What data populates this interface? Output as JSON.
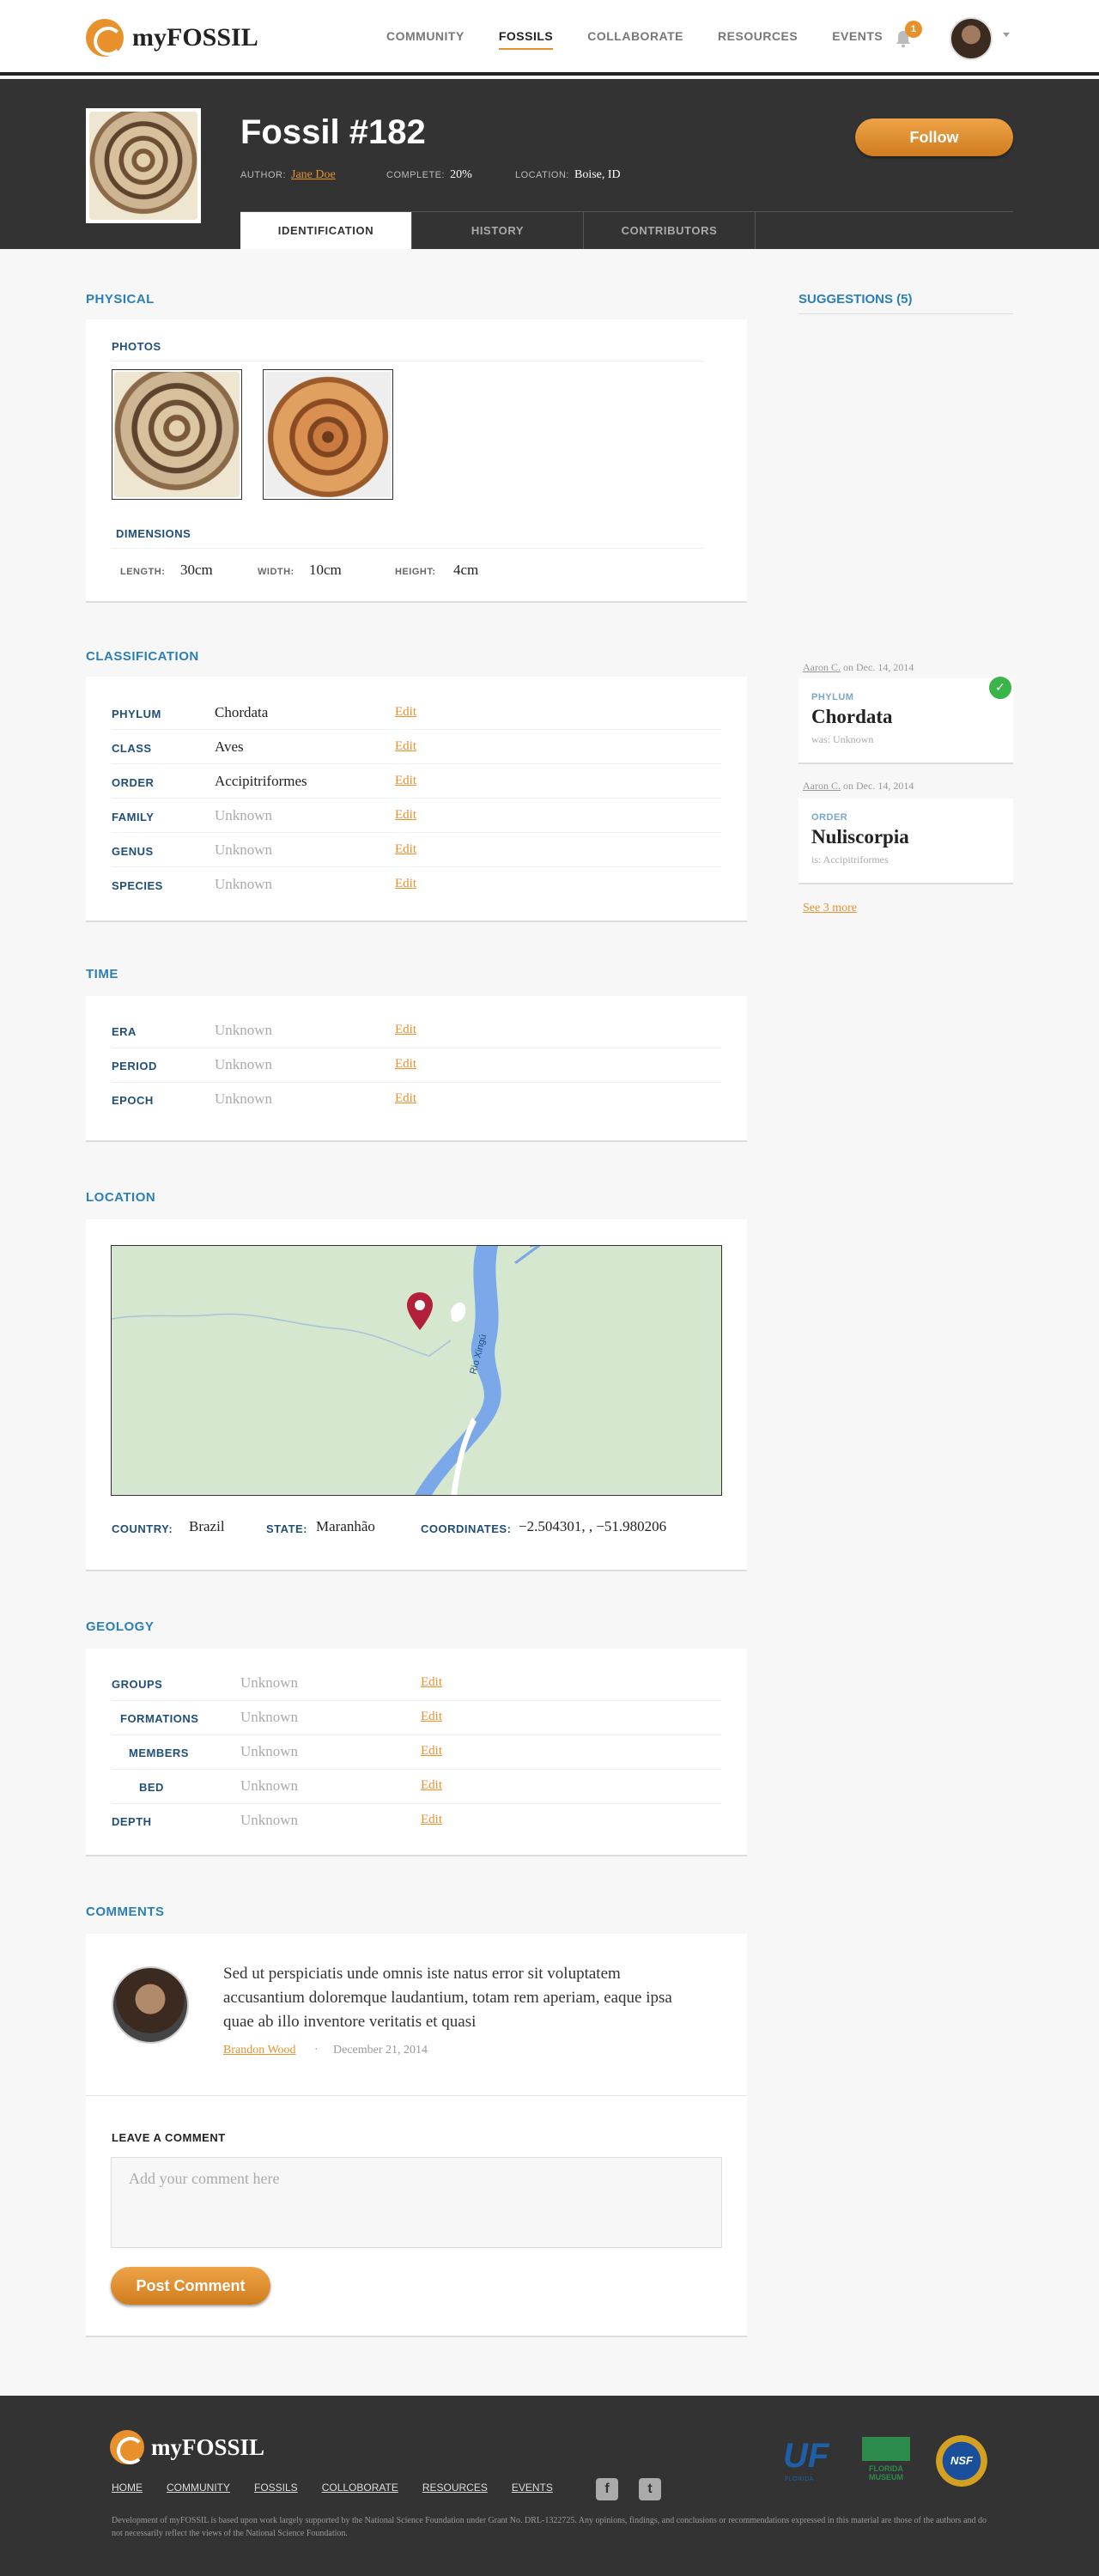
{
  "brand": {
    "name": "myFOSSIL"
  },
  "nav": {
    "items": [
      {
        "label": "COMMUNITY",
        "active": false
      },
      {
        "label": "FOSSILS",
        "active": true
      },
      {
        "label": "COLLABORATE",
        "active": false
      },
      {
        "label": "RESOURCES",
        "active": false
      },
      {
        "label": "EVENTS",
        "active": false
      }
    ],
    "notification_count": "1"
  },
  "header": {
    "title": "Fossil #182",
    "author_label": "AUTHOR:",
    "author": "Jane Doe",
    "complete_label": "COMPLETE:",
    "complete": "20%",
    "location_label": "LOCATION:",
    "location": "Boise, ID",
    "follow_label": "Follow",
    "tabs": [
      "IDENTIFICATION",
      "HISTORY",
      "CONTRIBUTORS"
    ],
    "active_tab": "IDENTIFICATION"
  },
  "physical": {
    "title": "PHYSICAL",
    "photos_label": "PHOTOS",
    "dimensions_label": "DIMENSIONS",
    "length_label": "LENGTH:",
    "length": "30cm",
    "width_label": "WIDTH:",
    "width": "10cm",
    "height_label": "HEIGHT:",
    "height": "4cm"
  },
  "edit_label": "Edit",
  "classification": {
    "title": "CLASSIFICATION",
    "rows": [
      {
        "label": "PHYLUM",
        "value": "Chordata",
        "known": true
      },
      {
        "label": "CLASS",
        "value": "Aves",
        "known": true
      },
      {
        "label": "ORDER",
        "value": "Accipitriformes",
        "known": true
      },
      {
        "label": "FAMILY",
        "value": "Unknown",
        "known": false
      },
      {
        "label": "GENUS",
        "value": "Unknown",
        "known": false
      },
      {
        "label": "SPECIES",
        "value": "Unknown",
        "known": false
      }
    ]
  },
  "time": {
    "title": "TIME",
    "rows": [
      {
        "label": "ERA",
        "value": "Unknown"
      },
      {
        "label": "PERIOD",
        "value": "Unknown"
      },
      {
        "label": "EPOCH",
        "value": "Unknown"
      }
    ]
  },
  "location": {
    "title": "LOCATION",
    "map_river_label": "Rio Xingú",
    "country_label": "COUNTRY:",
    "country": "Brazil",
    "state_label": "STATE:",
    "state": "Maranhão",
    "coordinates_label": "COORDINATES:",
    "coordinates": "−2.504301, , −51.980206"
  },
  "geology": {
    "title": "GEOLOGY",
    "rows": [
      {
        "label": "GROUPS",
        "value": "Unknown"
      },
      {
        "label": "FORMATIONS",
        "value": "Unknown"
      },
      {
        "label": "MEMBERS",
        "value": "Unknown"
      },
      {
        "label": "BED",
        "value": "Unknown"
      },
      {
        "label": "DEPTH",
        "value": "Unknown"
      }
    ]
  },
  "suggestions": {
    "title": "SUGGESTIONS (5)",
    "items": [
      {
        "by": "Aaron C.",
        "date": "on Dec. 14, 2014",
        "kind": "PHYLUM",
        "name": "Chordata",
        "was": "was: Unknown",
        "accepted": true
      },
      {
        "by": "Aaron C.",
        "date": "on Dec. 14, 2014",
        "kind": "ORDER",
        "name": "Nuliscorpia",
        "was": "is: Accipitriformes",
        "accepted": false
      }
    ],
    "see_more": "See 3 more"
  },
  "comments": {
    "title": "COMMENTS",
    "items": [
      {
        "text": "Sed ut perspiciatis unde omnis iste natus error sit voluptatem accusantium doloremque laudantium, totam rem aperiam, eaque ipsa quae ab illo inventore veritatis et quasi",
        "author": "Brandon Wood",
        "separator": "·",
        "date": "December 21, 2014"
      }
    ],
    "leave_label": "LEAVE A COMMENT",
    "placeholder": "Add your comment here",
    "post_label": "Post Comment"
  },
  "footer": {
    "brand": "myFOSSIL",
    "links": [
      "HOME",
      "COMMUNITY",
      "FOSSILS",
      "COLLOBORATE",
      "RESOURCES",
      "EVENTS"
    ],
    "social": [
      "f",
      "t"
    ],
    "note": "Development of myFOSSIL is based upon work largely supported by the National Science Foundation under Grant No. DRL-1322725. Any opinions, findings, and conclusions or recommendations expressed in this material are those of the authors and do not necessarily reflect the views of the National Science Foundation.",
    "partners": {
      "uf": "UF",
      "uf_sub": "FLORIDA",
      "flmnh": "FLORIDA MUSEUM",
      "nsf": "NSF"
    }
  },
  "colors": {
    "accent": "#e8912c",
    "link_blue": "#2a7fb8",
    "dark": "#333333",
    "success": "#3bb54a"
  },
  "icons": [
    "bell-icon",
    "logo-spiral-icon",
    "map-pin-icon",
    "check-icon",
    "facebook-icon",
    "twitter-icon"
  ]
}
